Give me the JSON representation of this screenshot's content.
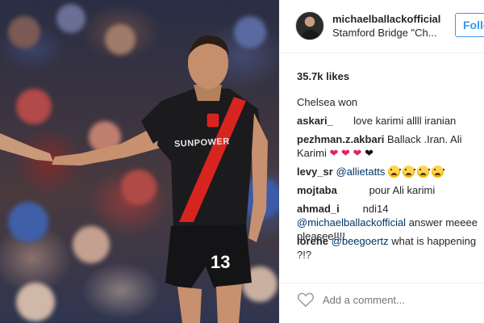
{
  "post": {
    "username": "michaelballackofficial",
    "location": "Stamford Bridge \"Ch...",
    "follow_label": "Follow",
    "likes": "35.7k likes"
  },
  "comments": [
    {
      "user": "",
      "text": "Chelsea won"
    },
    {
      "user": "askari_",
      "text": "love karimi allll iranian"
    },
    {
      "user": "pezhman.z.akbari",
      "text": "Ballack .Iran. Ali Karimi"
    },
    {
      "user": "levy_sr",
      "mention": "@allietatts"
    },
    {
      "user": "mojtaba",
      "text": "pour Ali karimi"
    },
    {
      "user": "ahmad_i",
      "text_before": "ndi14",
      "mention": "@michaelballackofficial",
      "text": " answer meeee pleasee!!!!"
    },
    {
      "user": "lorehe",
      "mention": "@beegoertz",
      "text": " what is happening ?!?"
    }
  ],
  "photo": {
    "shirt_number": "13",
    "sponsor": "SUNPOWER"
  },
  "footer": {
    "add_comment_placeholder": "Add a comment..."
  },
  "colors": {
    "accent": "#3897f0",
    "mention": "#003569",
    "heart": "#e0245e",
    "border": "#efefef"
  }
}
